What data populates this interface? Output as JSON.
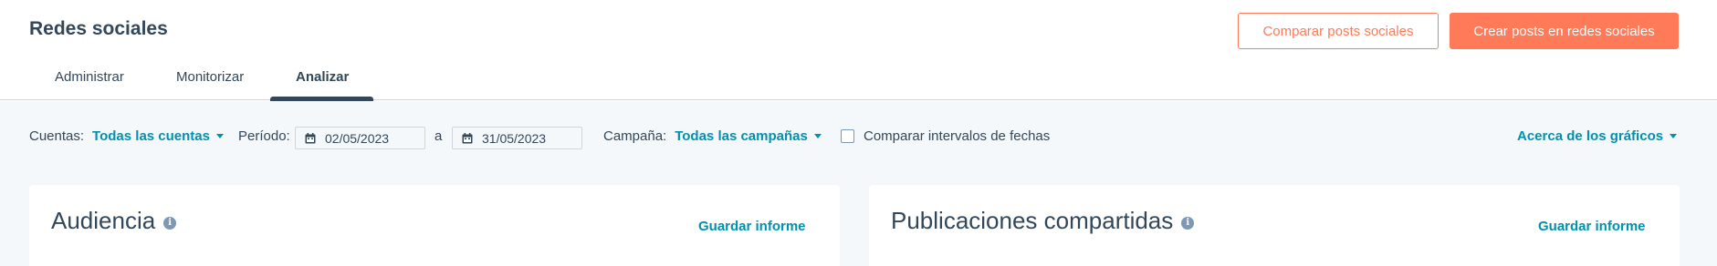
{
  "page": {
    "title": "Redes sociales"
  },
  "actions": {
    "compare_label": "Comparar posts sociales",
    "create_label": "Crear posts en redes sociales"
  },
  "tabs": [
    {
      "label": "Administrar",
      "active": false
    },
    {
      "label": "Monitorizar",
      "active": false
    },
    {
      "label": "Analizar",
      "active": true
    }
  ],
  "filters": {
    "accounts_label": "Cuentas:",
    "accounts_value": "Todas las cuentas",
    "period_label": "Período:",
    "date_from": "02/05/2023",
    "date_separator": "a",
    "date_to": "31/05/2023",
    "campaign_label": "Campaña:",
    "campaign_value": "Todas las campañas",
    "compare_dates_label": "Comparar intervalos de fechas",
    "compare_dates_checked": false,
    "about_charts": "Acerca de los gráficos"
  },
  "cards": [
    {
      "title": "Audiencia",
      "save_label": "Guardar informe"
    },
    {
      "title": "Publicaciones compartidas",
      "save_label": "Guardar informe"
    }
  ],
  "colors": {
    "accent": "#ff7a59",
    "link": "#0091ae",
    "text": "#33475b",
    "background": "#f5f8fa"
  },
  "icons": {
    "calendar": "calendar-icon",
    "info": "info-icon",
    "caret": "chevron-down-icon"
  }
}
